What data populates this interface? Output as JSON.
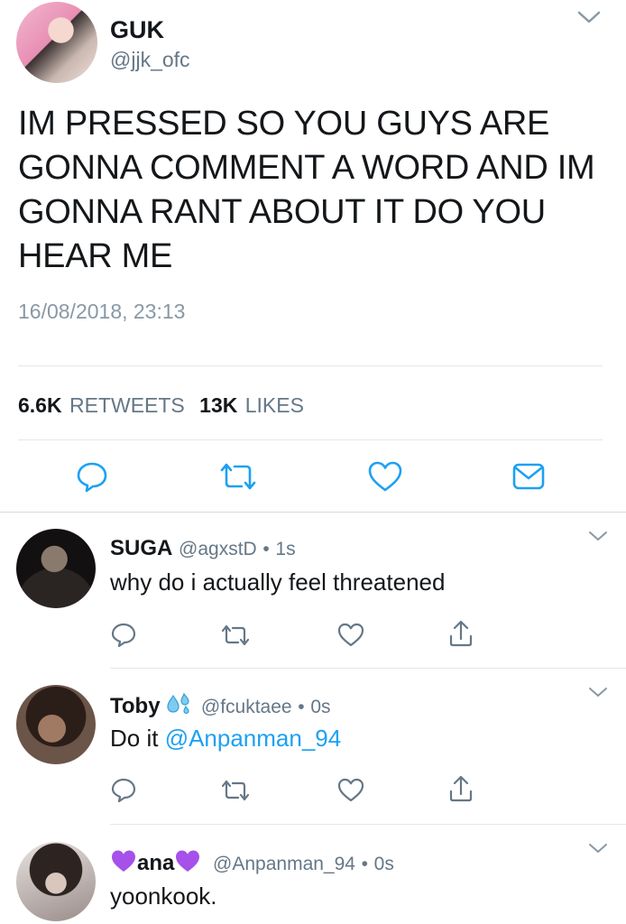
{
  "main_tweet": {
    "display_name": "GUK",
    "handle": "@jjk_ofc",
    "text_lines": [
      "IM PRESSED SO YOU GUYS ARE",
      "GONNA COMMENT A WORD AND IM",
      "GONNA RANT ABOUT IT DO YOU",
      "HEAR ME"
    ],
    "timestamp": "16/08/2018, 23:13",
    "retweets_count": "6.6K",
    "retweets_label": "RETWEETS",
    "likes_count": "13K",
    "likes_label": "LIKES"
  },
  "replies": [
    {
      "display_name": "SUGA",
      "handle": "@agxstD",
      "separator": "•",
      "time": "1s",
      "text": "why do i actually feel threatened"
    },
    {
      "display_name": "Toby",
      "handle": "@fcuktaee",
      "separator": "•",
      "time": "0s",
      "text_prefix": "Do it ",
      "mention": "@Anpanman_94"
    },
    {
      "display_name": "ana",
      "handle": "@Anpanman_94",
      "separator": "•",
      "time": "0s",
      "text": "yoonkook."
    }
  ],
  "colors": {
    "accent": "#1da1f2",
    "icon_gray": "#657786",
    "divider": "#e1e8ed",
    "purple_heart": "#a651ea"
  },
  "icons": [
    "chevron-down-icon",
    "reply-icon",
    "retweet-icon",
    "like-icon",
    "message-icon",
    "share-icon",
    "sweat-droplets-icon",
    "purple-heart-icon"
  ]
}
